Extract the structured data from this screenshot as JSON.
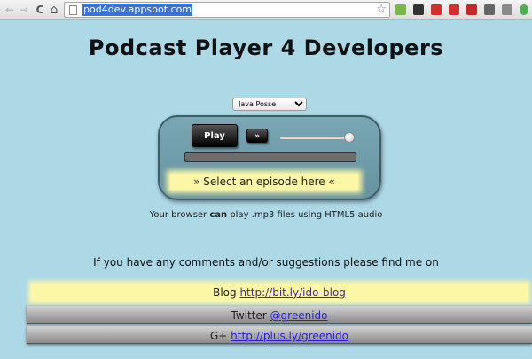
{
  "browser": {
    "url": "pod4dev.appspot.com",
    "back_icon": "←",
    "forward_icon": "→",
    "reload_icon": "C",
    "home_icon": "⌂",
    "star_icon": "☆",
    "extension_colors": [
      "#7ab648",
      "#333333",
      "#d32f2f",
      "#d32f2f",
      "#c62828",
      "#666666",
      "#8a8a8a",
      "#4caf50",
      "#666666"
    ]
  },
  "page": {
    "title": "Podcast Player 4 Developers",
    "podcast_select": {
      "selected": "Java Posse",
      "options": [
        "Java Posse"
      ]
    },
    "player": {
      "play_label": "Play",
      "skip_label": "»",
      "volume_level": 0.95,
      "progress": 0,
      "episode_label": "» Select an episode here «"
    },
    "support": {
      "prefix": "Your browser ",
      "emphasis": "can",
      "suffix": " play .mp3 files using HTML5 audio"
    },
    "comments_text": "If you have any comments and/or suggestions please find me on",
    "links": {
      "blog": {
        "label": "Blog ",
        "url_text": "http://bit.ly/ido-blog"
      },
      "twitter": {
        "label": "Twitter ",
        "url_text": "@greenido"
      },
      "gplus": {
        "label": "G+ ",
        "url_text": "http://plus.ly/greenido"
      }
    }
  }
}
